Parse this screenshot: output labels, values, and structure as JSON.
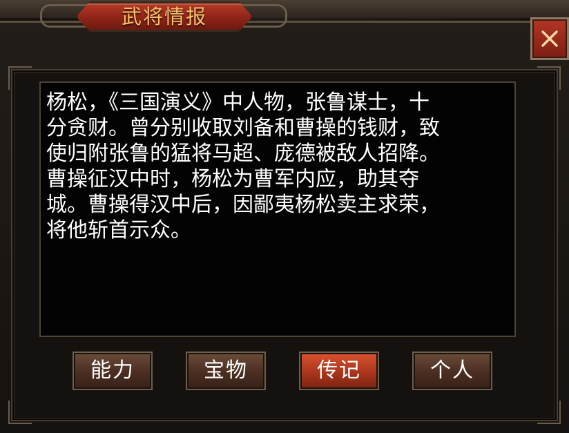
{
  "dialog": {
    "title": "武将情报",
    "close_label": "×"
  },
  "biography": {
    "text": "杨松，《三国演义》中人物，张鲁谋士，十\n分贪财。曾分别收取刘备和曹操的钱财，致\n使归附张鲁的猛将马超、庞德被敌人招降。\n曹操征汉中时，杨松为曹军内应，助其夺\n城。曹操得汉中后，因鄙夷杨松卖主求荣，\n将他斩首示众。"
  },
  "tabs": [
    {
      "label": "能力",
      "active": false
    },
    {
      "label": "宝物",
      "active": false
    },
    {
      "label": "传记",
      "active": true
    },
    {
      "label": "个人",
      "active": false
    }
  ],
  "colors": {
    "title_text": "#f5c06a",
    "title_plate": "#8e2417",
    "active_tab": "#a9361c",
    "inactive_tab": "#4a2e22"
  }
}
